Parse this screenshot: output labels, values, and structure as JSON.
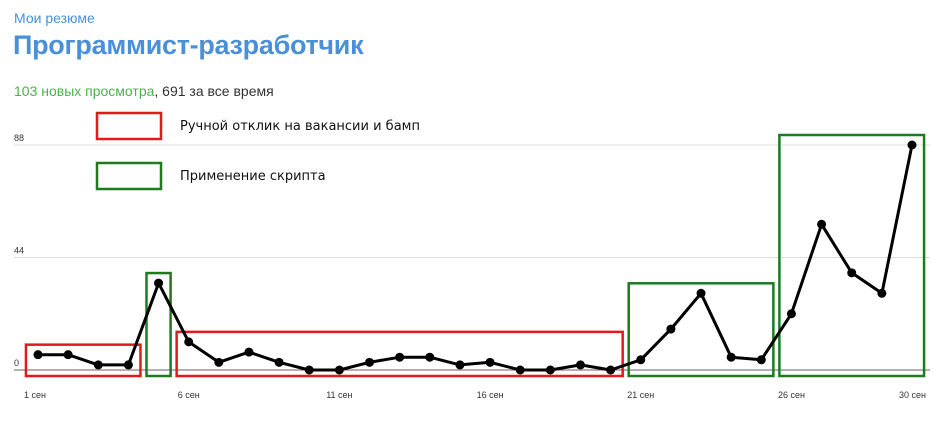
{
  "header": {
    "breadcrumb": "Мои резюме",
    "title": "Программист-разработчик",
    "views_new": "103 новых просмотра",
    "views_sep": ",",
    "views_total": " 691 за все время"
  },
  "colors": {
    "red_box": "#e21a1a",
    "green_box": "#1f7a1f",
    "line": "#000000",
    "grid": "#dddddd",
    "baseline": "#666666"
  },
  "legend": [
    {
      "label": "Ручной отклик на вакансии и бамп",
      "color": "#e21a1a"
    },
    {
      "label": "Применение скрипта",
      "color": "#1f7a1f"
    }
  ],
  "chart_data": {
    "type": "line",
    "x": [
      "1 сен",
      "2 сен",
      "3 сен",
      "4 сен",
      "5 сен",
      "6 сен",
      "7 сен",
      "8 сен",
      "9 сен",
      "10 сен",
      "11 сен",
      "12 сен",
      "13 сен",
      "14 сен",
      "15 сен",
      "16 сен",
      "17 сен",
      "18 сен",
      "19 сен",
      "20 сен",
      "21 сен",
      "22 сен",
      "23 сен",
      "24 сен",
      "25 сен",
      "26 сен",
      "27 сен",
      "28 сен",
      "29 сен",
      "30 сен"
    ],
    "values": [
      6,
      6,
      2,
      2,
      34,
      11,
      3,
      7,
      3,
      0,
      0,
      3,
      5,
      5,
      2,
      3,
      0,
      0,
      2,
      0,
      4,
      16,
      30,
      5,
      4,
      22,
      57,
      38,
      30,
      88
    ],
    "x_tick_labels": [
      "1 сен",
      "6 сен",
      "11 сен",
      "16 сен",
      "21 сен",
      "26 сен",
      "30 сен"
    ],
    "y_ticks": [
      0,
      44,
      88
    ],
    "ylim": [
      0,
      88
    ],
    "grid": true,
    "legend_position": "top-left",
    "highlight_ranges": [
      {
        "type": "manual",
        "from": "1 сен",
        "to": "4 сен"
      },
      {
        "type": "script",
        "from": "5 сен",
        "to": "5 сен"
      },
      {
        "type": "manual",
        "from": "6 сен",
        "to": "20 сен"
      },
      {
        "type": "script",
        "from": "21 сен",
        "to": "25 сен"
      },
      {
        "type": "script",
        "from": "26 сен",
        "to": "30 сен"
      }
    ]
  }
}
